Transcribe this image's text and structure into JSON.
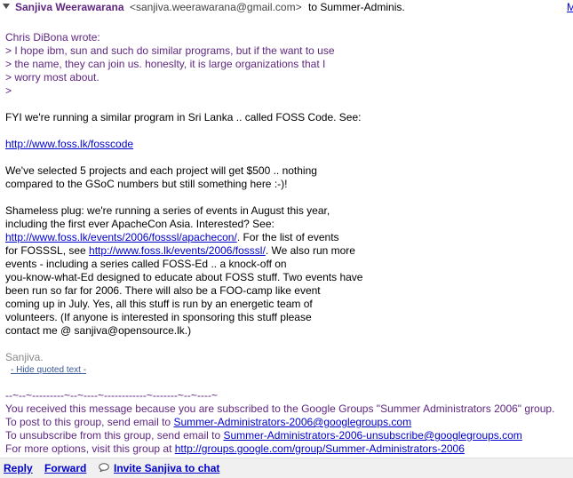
{
  "header": {
    "sender_name": "Sanjiva Weerawarana",
    "sender_email": "<sanjiva.weerawarana@gmail.com>",
    "recipients": "to Summer-Adminis.",
    "more_link": "M"
  },
  "quote": {
    "attribution": "Chris DiBona wrote:",
    "lines": [
      "> I hope ibm, sun and such do similar programs, but if the want to use",
      "> the name, they can join us. honeslty, it is large organizations that I",
      "> worry most about.",
      ">"
    ]
  },
  "body": {
    "p1": "FYI we're running a similar program in Sri Lanka .. called FOSS Code. See:",
    "link1": "http://www.foss.lk/fosscode",
    "p2_line1": "We've selected 5 projects and each project will get $500 .. nothing",
    "p2_line2": "compared to the GSoC numbers but still something here :-)!",
    "p3_line1": "Shameless plug: we're running a series of events in August this year,",
    "p3_line2": "including the first ever ApacheCon Asia. Interested? See:",
    "p3_link_apachecon": "http://www.foss.lk/events/2006/fosssl/apachecon/",
    "p3_line3_tail": ". For the list of events",
    "p3_line4_head": "for FOSSSL, see ",
    "p3_link_fosssl": "http://www.foss.lk/events/2006/fosssl/",
    "p3_line4_tail": ". We also run more",
    "p3_line5": "events - including a series called FOSS-Ed .. a knock-off on",
    "p3_line6": "you-know-what-Ed designed to educate about FOSS stuff. Two events have",
    "p3_line7": "been run so far for 2006. There will also be a FOO-camp like event",
    "p3_line8": "coming up in July. Yes, all this stuff is run by an energetic team of",
    "p3_line9": "volunteers. (If anyone is interested in sponsoring this stuff please",
    "p3_line10": "contact me @ sanjiva@opensource.lk.)",
    "signature": "Sanjiva.",
    "hide_quoted": "- Hide quoted text -"
  },
  "footer": {
    "divider_top": "--~--~---------~--~----~------------~-------~--~----~",
    "line1": "You received this message because you are subscribed to the Google Groups \"Summer Administrators 2006\" group.",
    "line2_head": "To post to this group, send email to ",
    "line2_link": "Summer-Administrators-2006@googlegroups.com",
    "line3_head": "To unsubscribe from this group, send email to ",
    "line3_link": "Summer-Administrators-2006-unsubscribe@googlegroups.com",
    "line4_head": "For more options, visit this group at ",
    "line4_link": "http://groups.google.com/group/Summer-Administrators-2006",
    "divider_bottom": "-~----------~----~----~----~------~----~------~--~---"
  },
  "actions": {
    "reply": "Reply",
    "forward": "Forward",
    "invite_chat": "Invite Sanjiva to chat"
  },
  "colors": {
    "sender": "#5f2780",
    "link": "#0000cc",
    "quoted": "#5f2780",
    "signature": "#888888"
  },
  "icons": [
    "expand-caret-icon",
    "chat-bubble-icon"
  ]
}
